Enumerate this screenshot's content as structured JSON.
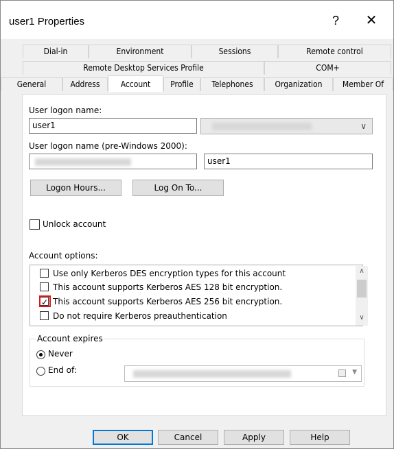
{
  "window": {
    "title": "user1 Properties",
    "help_glyph": "?",
    "close_glyph": "✕"
  },
  "tabs": {
    "row1": [
      "Dial-in",
      "Environment",
      "Sessions",
      "Remote control"
    ],
    "row2": [
      "Remote Desktop Services Profile",
      "COM+"
    ],
    "row3": [
      "General",
      "Address",
      "Account",
      "Profile",
      "Telephones",
      "Organization",
      "Member Of"
    ],
    "active": "Account"
  },
  "account": {
    "logon_name_label": "User logon name:",
    "logon_name_value": "user1",
    "pre2000_label": "User logon name (pre-Windows 2000):",
    "pre2000_value": "user1",
    "logon_hours_label": "Logon Hours...",
    "logon_on_to_label": "Log On To...",
    "unlock_label": "Unlock account",
    "options_label": "Account options:",
    "options": [
      {
        "label": "Use only Kerberos DES encryption types for this account",
        "checked": false
      },
      {
        "label": "This account supports Kerberos AES 128 bit encryption.",
        "checked": false
      },
      {
        "label": "This account supports Kerberos AES 256 bit encryption.",
        "checked": true
      },
      {
        "label": "Do not require Kerberos preauthentication",
        "checked": false
      }
    ],
    "expires_label": "Account expires",
    "never_label": "Never",
    "end_of_label": "End of:"
  },
  "buttons": {
    "ok": "OK",
    "cancel": "Cancel",
    "apply": "Apply",
    "help": "Help"
  }
}
